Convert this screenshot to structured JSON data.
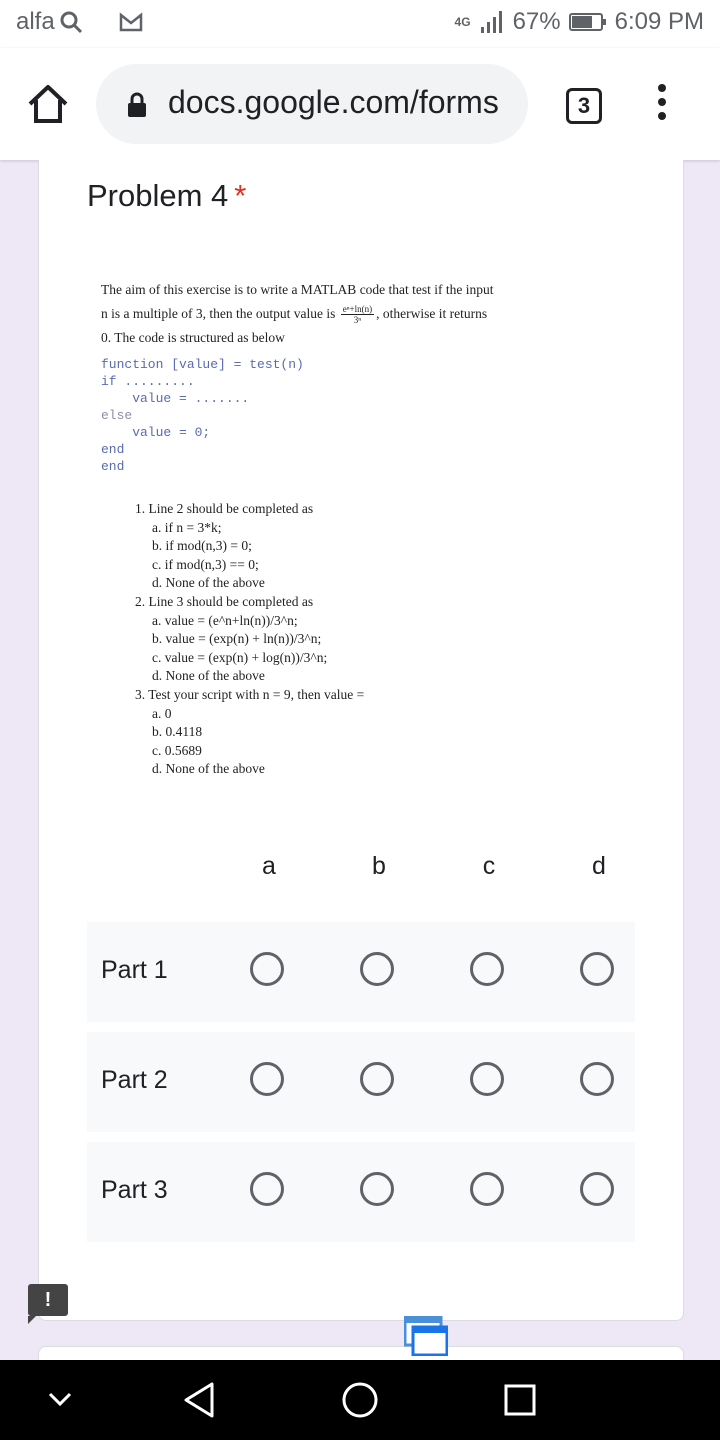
{
  "status_bar": {
    "left_text": "alfa",
    "network": "4G",
    "battery": "67%",
    "time": "6:09 PM"
  },
  "browser": {
    "url": "docs.google.com/forms",
    "tab_count": "3"
  },
  "question": {
    "title": "Problem 4",
    "required_mark": "*",
    "text_line1": "The aim of this exercise is to write a MATLAB code that test if the input",
    "text_line2_pre": "n is a multiple of 3, then the output value is",
    "fraction_num": "eⁿ+ln(n)",
    "fraction_den": "3ⁿ",
    "text_line2_post": ", otherwise it returns",
    "text_line3": "0. The code is structured as below",
    "code": [
      "function [value] = test(n)",
      "if .........",
      "    value = .......",
      "else",
      "    value = 0;",
      "end",
      "end"
    ],
    "items": [
      {
        "q": "1. Line 2 should be completed as",
        "opts": [
          "a. if n = 3*k;",
          "b. if mod(n,3) = 0;",
          "c. if mod(n,3) == 0;",
          "d. None of the above"
        ]
      },
      {
        "q": "2. Line 3 should be completed as",
        "opts": [
          "a. value = (e^n+ln(n))/3^n;",
          "b. value = (exp(n) + ln(n))/3^n;",
          "c. value = (exp(n) + log(n))/3^n;",
          "d. None of the above"
        ]
      },
      {
        "q": "3. Test your script with n = 9, then value =",
        "opts": [
          "a. 0",
          "b. 0.4118",
          "c. 0.5689",
          "d. None of the above"
        ]
      }
    ]
  },
  "grid": {
    "columns": [
      "a",
      "b",
      "c",
      "d"
    ],
    "rows": [
      "Part 1",
      "Part 2",
      "Part 3"
    ]
  },
  "feedback_label": "!"
}
